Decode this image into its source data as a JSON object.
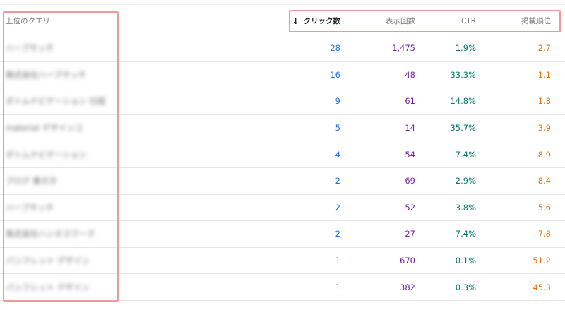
{
  "header": {
    "query_label": "上位のクエリ",
    "sort_arrow": "↓",
    "clicks_label": "クリック数",
    "impressions_label": "表示回数",
    "ctr_label": "CTR",
    "position_label": "掲載順位"
  },
  "rows": [
    {
      "query": "ハーブサッチ",
      "clicks": "28",
      "impressions": "1,475",
      "ctr": "1.9%",
      "position": "2.7"
    },
    {
      "query": "株式会社ハーブサッチ",
      "clicks": "16",
      "impressions": "48",
      "ctr": "33.3%",
      "position": "1.1"
    },
    {
      "query": "ボトムナビゲーション 仕組",
      "clicks": "9",
      "impressions": "61",
      "ctr": "14.8%",
      "position": "1.8"
    },
    {
      "query": "material デザインコ",
      "clicks": "5",
      "impressions": "14",
      "ctr": "35.7%",
      "position": "3.9"
    },
    {
      "query": "ボトムナビゲーション",
      "clicks": "4",
      "impressions": "54",
      "ctr": "7.4%",
      "position": "8.9"
    },
    {
      "query": "ブログ 書き方",
      "clicks": "2",
      "impressions": "69",
      "ctr": "2.9%",
      "position": "8.4"
    },
    {
      "query": "ハーブサッチ",
      "clicks": "2",
      "impressions": "52",
      "ctr": "3.8%",
      "position": "5.6"
    },
    {
      "query": "株式会社ハンヌスワーク",
      "clicks": "2",
      "impressions": "27",
      "ctr": "7.4%",
      "position": "7.8"
    },
    {
      "query": "パンフレット デザイン",
      "clicks": "1",
      "impressions": "670",
      "ctr": "0.1%",
      "position": "51.2"
    },
    {
      "query": "パンフレット デザイン",
      "clicks": "1",
      "impressions": "382",
      "ctr": "0.3%",
      "position": "45.3"
    }
  ],
  "colors": {
    "clicks": "#1a73e8",
    "impressions": "#7b1fa2",
    "ctr": "#00796b",
    "position": "#e8710a",
    "highlight": "#ef9a9a"
  }
}
